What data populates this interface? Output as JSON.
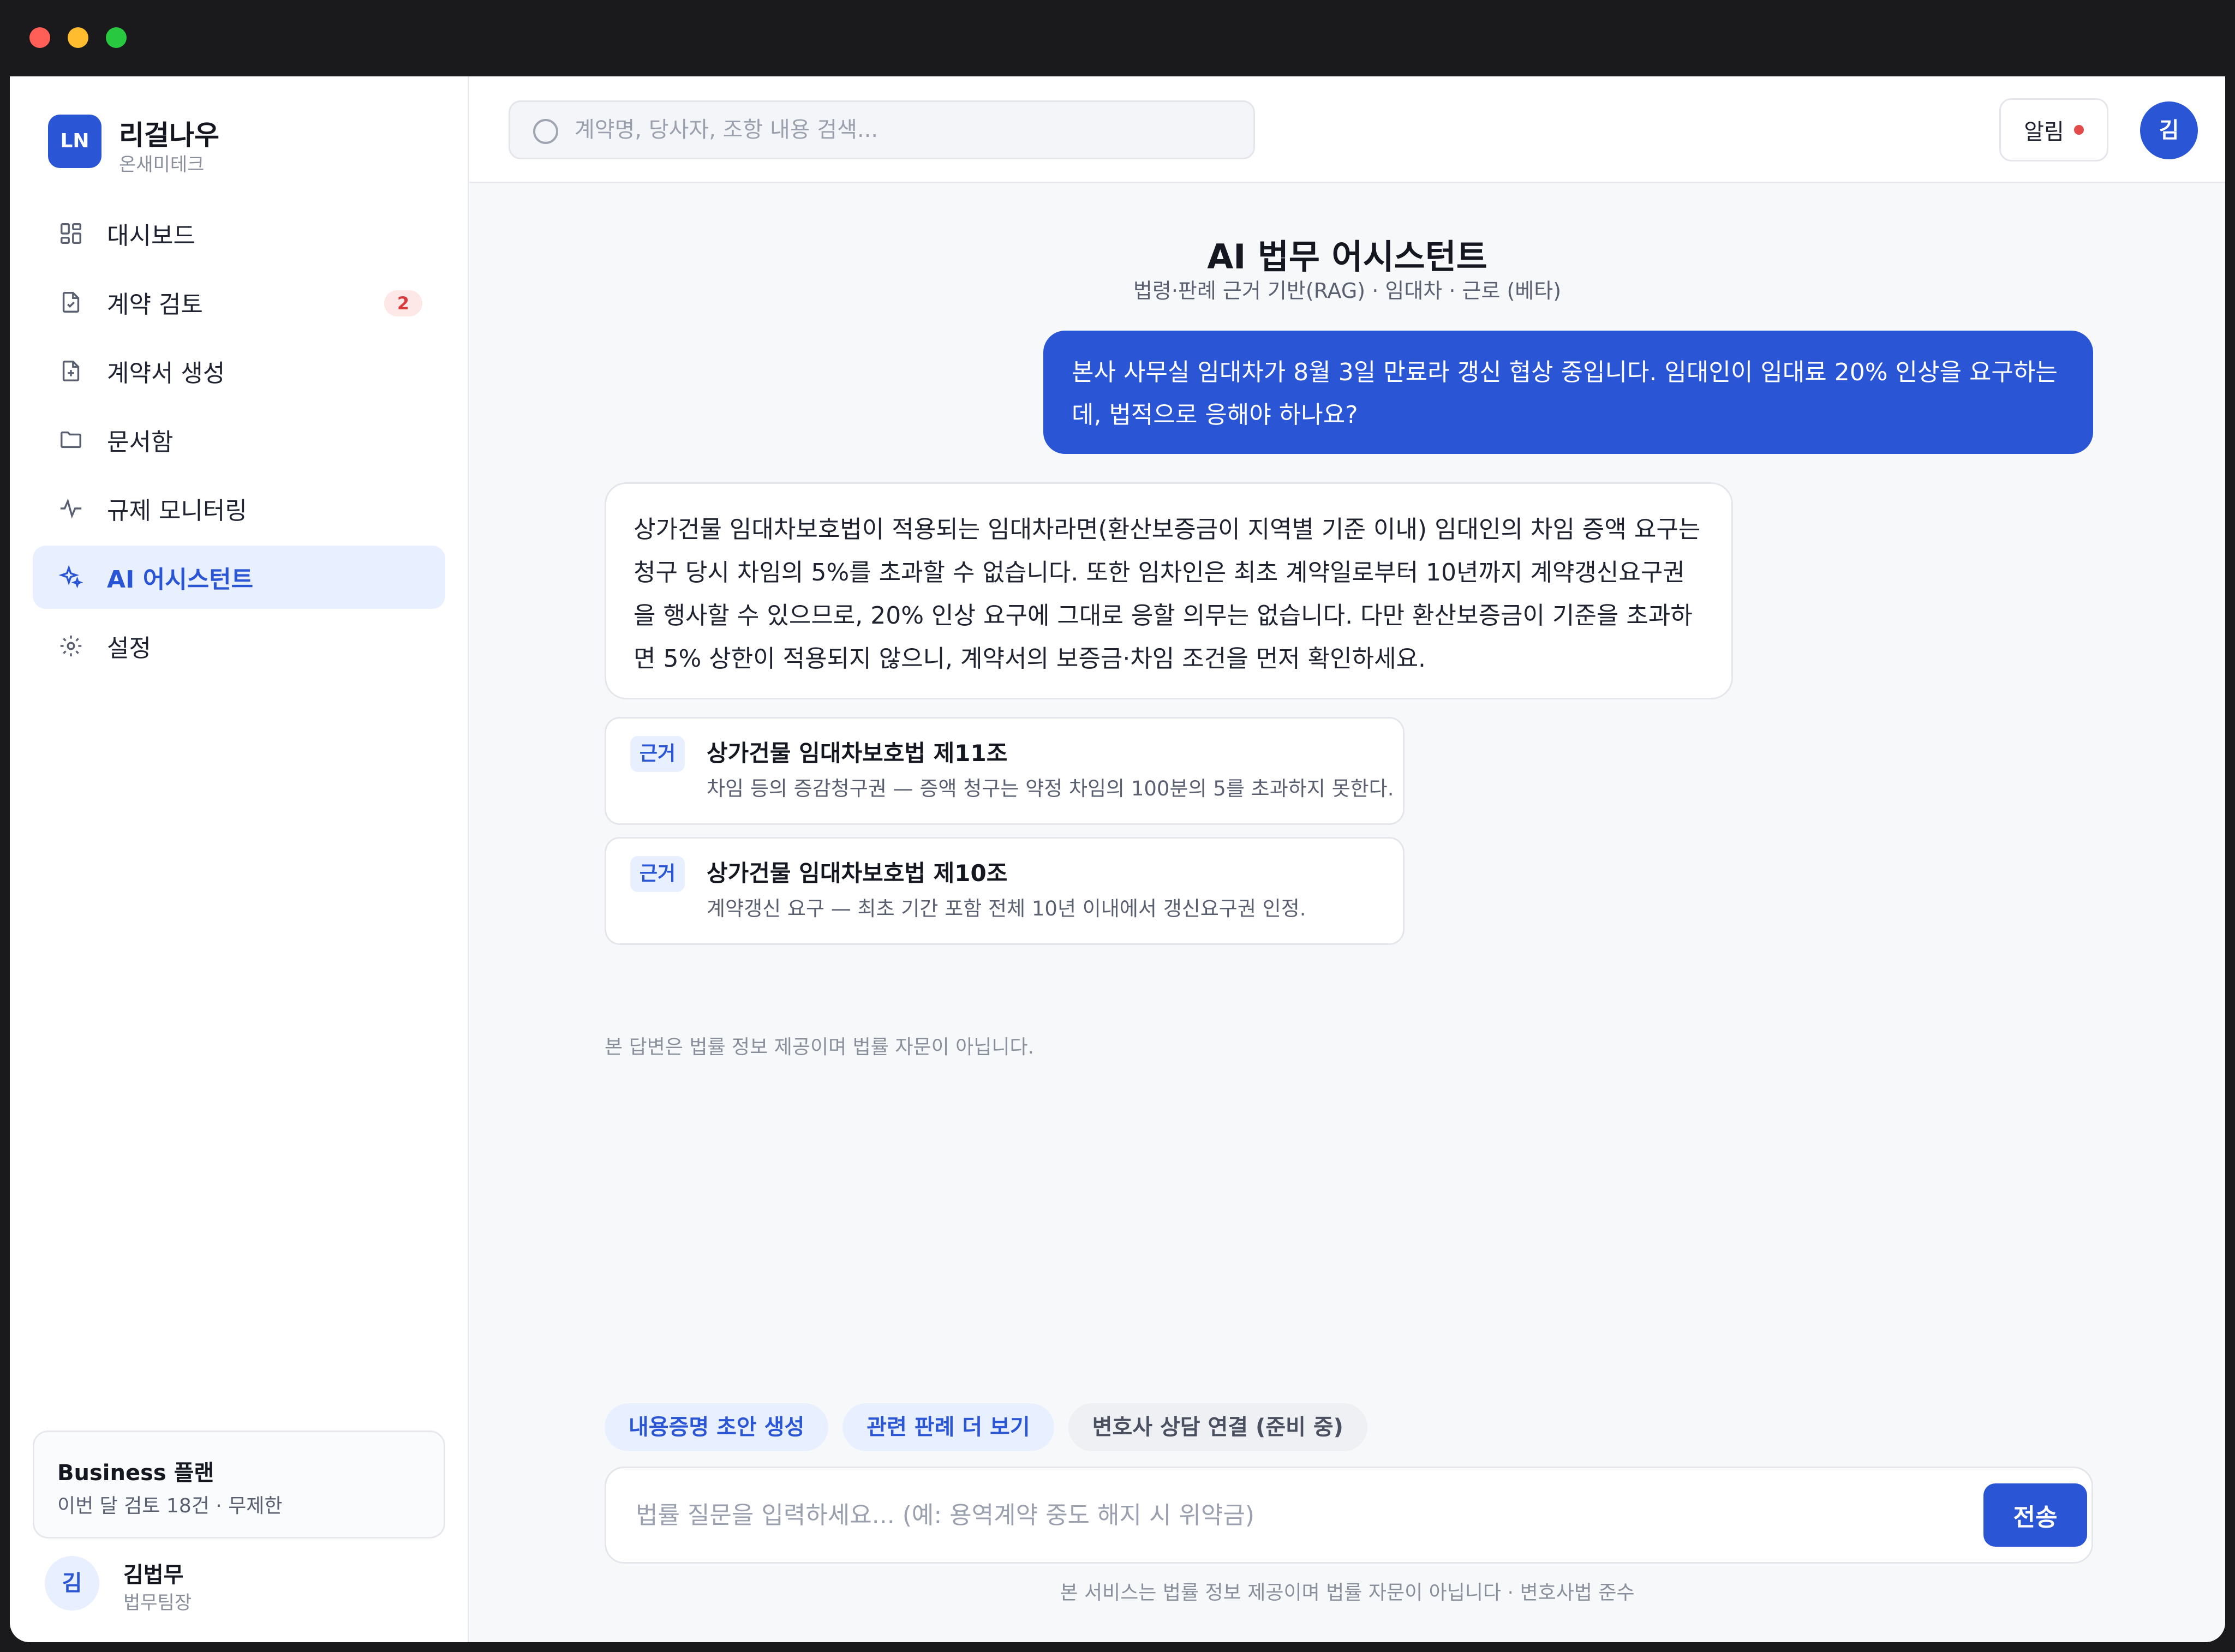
{
  "brand": {
    "logo_text": "LN",
    "name": "리걸나우",
    "org": "온새미테크"
  },
  "nav": [
    {
      "label": "대시보드",
      "icon": "dashboard-icon"
    },
    {
      "label": "계약 검토",
      "icon": "document-check-icon",
      "badge": "2"
    },
    {
      "label": "계약서 생성",
      "icon": "document-plus-icon"
    },
    {
      "label": "문서함",
      "icon": "folder-icon"
    },
    {
      "label": "규제 모니터링",
      "icon": "activity-icon"
    },
    {
      "label": "AI 어시스턴트",
      "icon": "sparkles-icon",
      "active": true
    },
    {
      "label": "설정",
      "icon": "gear-icon"
    }
  ],
  "plan": {
    "title": "Business 플랜",
    "usage": "이번 달 검토 18건 · 무제한"
  },
  "user": {
    "initial": "김",
    "name": "김법무",
    "role": "법무팀장"
  },
  "topbar": {
    "search_placeholder": "계약명, 당사자, 조항 내용 검색...",
    "notifications_label": "알림",
    "avatar_initial": "김"
  },
  "chat": {
    "title": "AI 법무 어시스턴트",
    "subtitle": "법령·판례 근거 기반(RAG) · 임대차 · 근로 (베타)",
    "user_message": "본사 사무실 임대차가 8월 3일 만료라 갱신 협상 중입니다. 임대인이 임대료 20% 인상을 요구하는데, 법적으로 응해야 하나요?",
    "ai_message": "상가건물 임대차보호법이 적용되는 임대차라면(환산보증금이 지역별 기준 이내) 임대인의 차임 증액 요구는 청구 당시 차임의 5%를 초과할 수 없습니다. 또한 임차인은 최초 계약일로부터 10년까지 계약갱신요구권을 행사할 수 있으므로, 20% 인상 요구에 그대로 응할 의무는 없습니다. 다만 환산보증금이 기준을 초과하면 5% 상한이 적용되지 않으니, 계약서의 보증금·차임 조건을 먼저 확인하세요.",
    "citations": [
      {
        "tag": "근거",
        "title": "상가건물 임대차보호법 제11조",
        "desc": "차임 등의 증감청구권 — 증액 청구는 약정 차임의 100분의 5를 초과하지 못한다."
      },
      {
        "tag": "근거",
        "title": "상가건물 임대차보호법 제10조",
        "desc": "계약갱신 요구 — 최초 기간 포함 전체 10년 이내에서 갱신요구권 인정."
      }
    ],
    "answer_disclaimer": "본 답변은 법률 정보 제공이며 법률 자문이 아닙니다.",
    "suggestions": [
      "내용증명 초안 생성",
      "관련 판례 더 보기",
      "변호사 상담 연결 (준비 중)"
    ],
    "composer_placeholder": "법률 질문을 입력하세요... (예: 용역계약 중도 해지 시 위약금)",
    "send_label": "전송",
    "footer_note": "본 서비스는 법률 정보 제공이며 법률 자문이 아닙니다 · 변호사법 준수"
  },
  "colors": {
    "accent": "#2a55d4",
    "accent_soft": "#e8efff",
    "badge_red": "#d93b3b"
  }
}
